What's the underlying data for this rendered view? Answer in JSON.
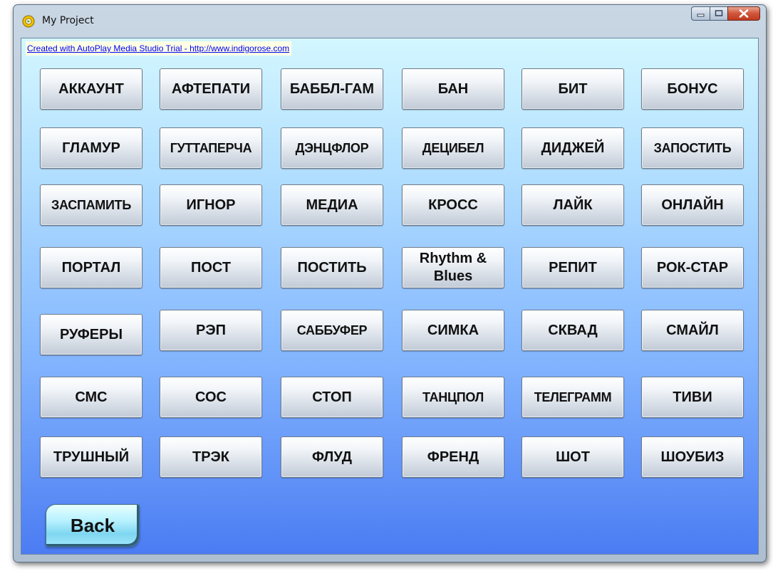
{
  "window": {
    "title": "My Project"
  },
  "trial_notice": "Created with AutoPlay Media Studio Trial - http://www.indigorose.com",
  "word_buttons": [
    "АККАУНТ",
    "АФТЕПАТИ",
    "БАББЛ-ГАМ",
    "БАН",
    "БИТ",
    "БОНУС",
    "ГЛАМУР",
    "ГУТТАПЕРЧА",
    "ДЭНЦФЛОР",
    "ДЕЦИБЕЛ",
    "ДИДЖЕЙ",
    "ЗАПОСТИТЬ",
    "ЗАСПАМИТЬ",
    "ИГНОР",
    "МЕДИА",
    "КРОСС",
    "ЛАЙК",
    "ОНЛАЙН",
    "ПОРТАЛ",
    "ПОСТ",
    "ПОСТИТЬ",
    "Rhythm & Blues",
    "РЕПИТ",
    "РОК-СТАР",
    "РУФЕРЫ",
    "РЭП",
    "САББУФЕР",
    "СИМКА",
    "СКВАД",
    "СМАЙЛ",
    "СМС",
    "СОС",
    "СТОП",
    "ТАНЦПОЛ",
    "ТЕЛЕГРАММ",
    "ТИВИ",
    "ТРУШНЫЙ",
    "ТРЭК",
    "ФЛУД",
    "ФРЕНД",
    "ШОТ",
    "ШОУБИЗ"
  ],
  "back_button": "Back"
}
